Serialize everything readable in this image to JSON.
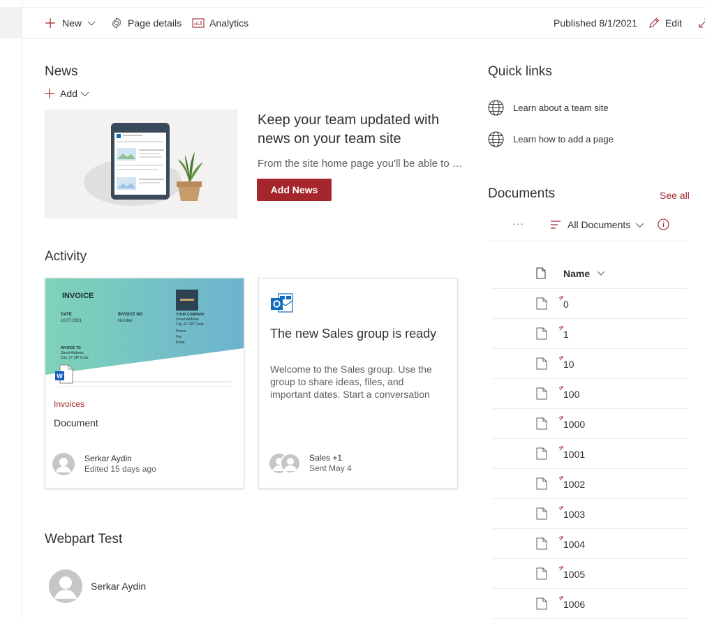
{
  "commandbar": {
    "new_label": "New",
    "page_details_label": "Page details",
    "analytics_label": "Analytics",
    "published": "Published 8/1/2021",
    "edit_label": "Edit"
  },
  "news": {
    "heading": "News",
    "add_label": "Add",
    "title": "Keep your team updated with news on your team site",
    "description": "From the site home page you'll be able to add posts",
    "button": "Add News"
  },
  "activity": {
    "heading": "Activity",
    "cards": [
      {
        "category": "Invoices",
        "title": "Document",
        "author": "Serkar Aydin",
        "meta": "Edited 15 days ago",
        "preview": {
          "invoice": "INVOICE",
          "date_label": "DATE",
          "date": "16.07.2021",
          "no_label": "INVOICE NO",
          "no": "Number",
          "company": "YOUR COMPANY",
          "address": "Street Address",
          "city": "City, ST ZIP Code",
          "phone": "Phone",
          "fax": "Fax",
          "email": "Email",
          "to_label": "INVOICE TO",
          "to_address": "Street Address",
          "to_city": "City, ST ZIP Code"
        }
      },
      {
        "title": "The new Sales group is ready",
        "description": "Welcome to the Sales group. Use the group to share ideas, files, and important dates. Start a conversation",
        "author": "Sales +1",
        "meta": "Sent May 4"
      }
    ]
  },
  "webpart": {
    "heading": "Webpart Test",
    "person": "Serkar Aydin"
  },
  "quicklinks": {
    "heading": "Quick links",
    "items": [
      "Learn about a team site",
      "Learn how to add a page"
    ]
  },
  "documents": {
    "heading": "Documents",
    "see_all": "See all",
    "more": "···",
    "view": "All Documents",
    "column_name": "Name",
    "files": [
      "0",
      "1",
      "10",
      "100",
      "1000",
      "1001",
      "1002",
      "1003",
      "1004",
      "1005",
      "1006"
    ]
  },
  "colors": {
    "accent": "#a4262c",
    "text": "#323130",
    "muted": "#605e5c"
  }
}
